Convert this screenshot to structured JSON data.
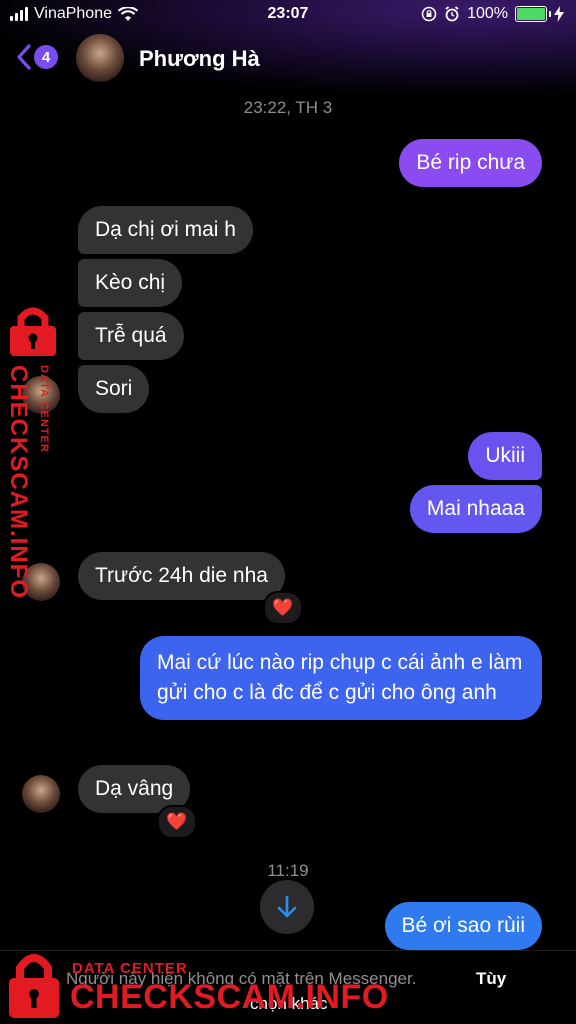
{
  "status_bar": {
    "carrier": "VinaPhone",
    "time": "23:07",
    "battery": "100%",
    "battery_level": 1.0
  },
  "header": {
    "back_count": "4",
    "contact_name": "Phương Hà"
  },
  "timestamps": {
    "first": "23:22, TH 3",
    "second": "11:19"
  },
  "messages": [
    {
      "direction": "out",
      "text": "Bé rip chưa"
    },
    {
      "direction": "in",
      "text": "Dạ chị ơi mai h"
    },
    {
      "direction": "in",
      "text": "Kèo chị"
    },
    {
      "direction": "in",
      "text": "Trễ quá"
    },
    {
      "direction": "in",
      "text": "Sori"
    },
    {
      "direction": "out",
      "text": "Ukiii"
    },
    {
      "direction": "out",
      "text": "Mai nhaaa"
    },
    {
      "direction": "in",
      "text": "Trước 24h die nha",
      "reaction": "❤️"
    },
    {
      "direction": "out",
      "text": "Mai cứ lúc nào rip chụp c cái ảnh e làm gửi cho c là đc để c gửi cho ông anh"
    },
    {
      "direction": "in",
      "text": "Dạ vâng",
      "reaction": "❤️"
    },
    {
      "direction": "out",
      "text": "Bé ơi sao rùii"
    }
  ],
  "footer": {
    "notice": "Người này hiện không có mặt trên Messenger.",
    "action": "Tùy",
    "action_line2": "chọn khác"
  },
  "watermark": {
    "small": "DATA CENTER",
    "big": "CHECKSCAM.INFO"
  },
  "colors": {
    "accent": "#7b4df0",
    "incoming_bubble": "#333336",
    "watermark_red": "#e21b22"
  }
}
